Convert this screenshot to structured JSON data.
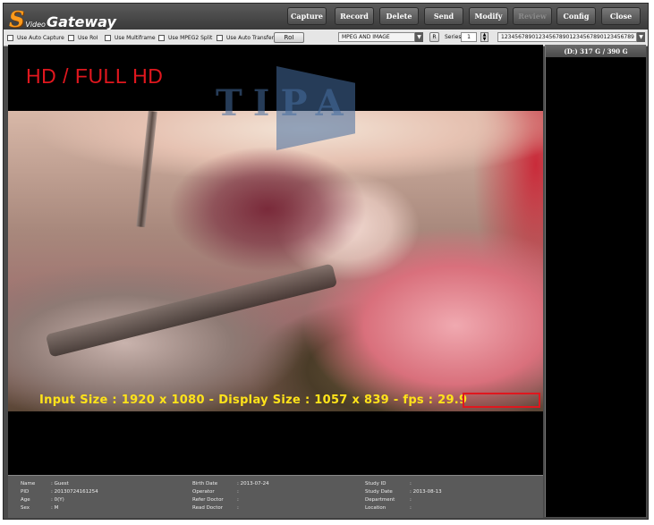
{
  "app": {
    "logo_s": "S",
    "logo_video": "Video",
    "logo_gateway": "Gateway"
  },
  "toolbar": {
    "buttons": [
      {
        "label": "Capture"
      },
      {
        "label": "Record"
      },
      {
        "label": "Delete"
      },
      {
        "label": "Send"
      },
      {
        "label": "Modify"
      },
      {
        "label": "Review",
        "disabled": true
      },
      {
        "label": "Config"
      },
      {
        "label": "Close"
      }
    ]
  },
  "options": {
    "auto_capture": "Use Auto Capture",
    "roi": "Use RoI",
    "multiframe": "Use Multiframe",
    "mpeg2_split": "Use MPEG2 Split",
    "auto_transfer": "Use Auto Transfer",
    "roi_button": "RoI",
    "format_value": "MPEG AND IMAGE",
    "r_button": "R",
    "series_label": "Series",
    "series_value": "1",
    "id_value": "123456789012345678901234567890123456789"
  },
  "viewer": {
    "resolution_label": "HD / FULL HD",
    "watermark": "TIPA",
    "status_text": "Input Size : 1920 x 1080 - Display Size : 1057 x 839 - fps : 29.9"
  },
  "storage": {
    "label": "(D:) 317 G / 390 G"
  },
  "patient": {
    "name_label": "Name",
    "name_value": ": Guest",
    "pid_label": "PID",
    "pid_value": ": 20130724161254",
    "age_label": "Age",
    "age_value": ": 0(Y)",
    "sex_label": "Sex",
    "sex_value": ": M",
    "birth_label": "Birth Date",
    "birth_value": ": 2013-07-24",
    "operator_label": "Operator",
    "operator_value": ":",
    "refer_label": "Refer Doctor",
    "refer_value": ":",
    "read_label": "Read Doctor",
    "read_value": ":",
    "study_id_label": "Study ID",
    "study_id_value": ":",
    "study_date_label": "Study Date",
    "study_date_value": ": 2013-08-13",
    "department_label": "Department",
    "department_value": ":",
    "location_label": "Location",
    "location_value": ":"
  }
}
